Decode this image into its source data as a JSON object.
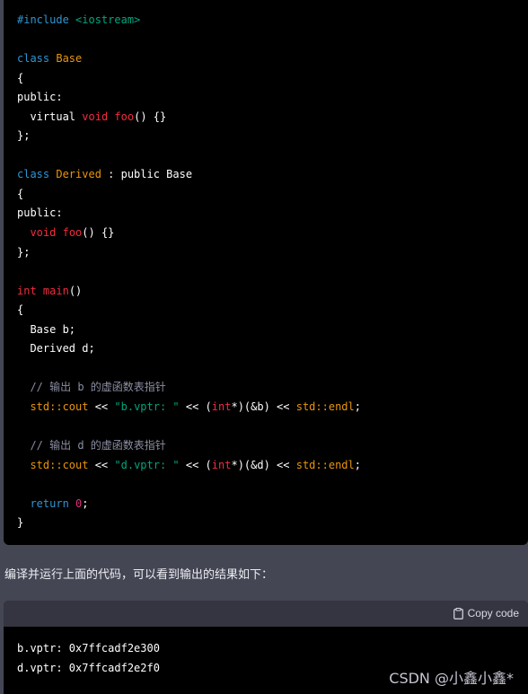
{
  "code": {
    "include": "#include",
    "header": "<iostream>",
    "kw_class": "class",
    "kw_public": "public:",
    "kw_virtual": "virtual",
    "kw_void": "void",
    "kw_int": "int",
    "kw_return": "return",
    "base_name": "Base",
    "derived_name": "Derived",
    "inherit": " : public Base",
    "foo_decl": "foo",
    "foo_body": "() {}",
    "open_brace": "{",
    "close_brace_semi": "};",
    "close_brace": "}",
    "main_name": "main",
    "main_parens": "()",
    "var_b": "Base b;",
    "var_d": "Derived d;",
    "comment_b": "// 输出 b 的虚函数表指针",
    "comment_d": "// 输出 d 的虚函数表指针",
    "std_cout": "std::cout",
    "op_shift": " << ",
    "str_b": "\"b.vptr: \"",
    "str_d": "\"d.vptr: \"",
    "cast_open": "(",
    "cast_type": "int",
    "cast_close_b": "*)(&b)",
    "cast_close_d": "*)(&d)",
    "std_endl": "std::endl",
    "semi": ";",
    "zero": "0"
  },
  "paragraph": "编译并运行上面的代码，可以看到输出的结果如下：",
  "output": {
    "copy_label": "Copy code",
    "lines": [
      "b.vptr: 0x7ffcadf2e300",
      "d.vptr: 0x7ffcadf2e2f0"
    ]
  },
  "watermark": "CSDN @小鑫小鑫*"
}
